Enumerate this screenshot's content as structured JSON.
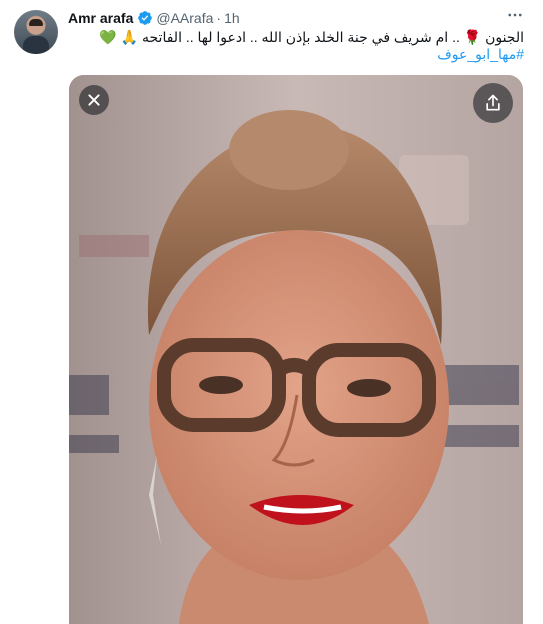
{
  "tweet": {
    "author_name": "Amr arafa",
    "author_handle": "@AArafa",
    "separator": "·",
    "time": "1h",
    "text_line1": "الجنون 🌹 .. ام شريف في جنة الخلد بإذن الله .. ادعوا لها .. الفاتحه 🙏 💚",
    "hashtag": "#مها_ابو_عوف"
  },
  "icons": {
    "verified": "verified-badge-icon",
    "more": "more-icon",
    "close": "close-icon",
    "share": "share-icon"
  },
  "colors": {
    "link": "#1d9bf0",
    "verified": "#1d9bf0",
    "muted": "#536471",
    "overlay": "#0f1419"
  }
}
